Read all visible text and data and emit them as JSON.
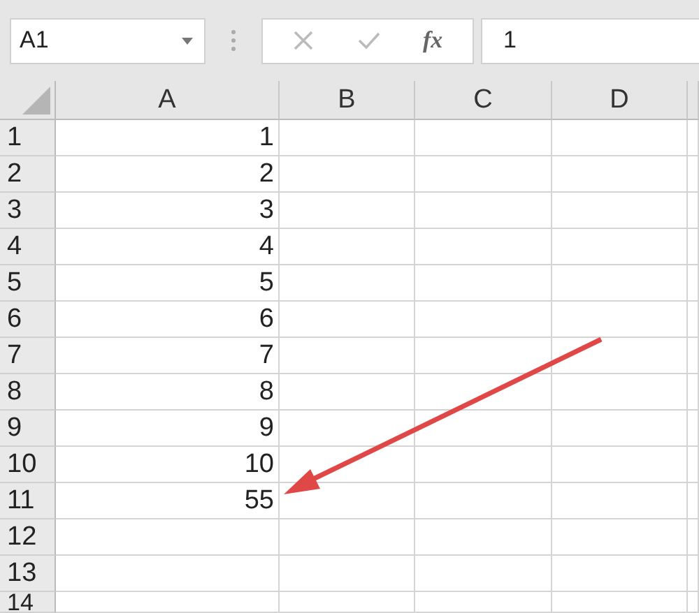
{
  "formula_bar": {
    "name_box": "A1",
    "function_button": "fx",
    "value": "1"
  },
  "columns": [
    "A",
    "B",
    "C",
    "D"
  ],
  "rows": [
    {
      "number": "1",
      "cells": [
        "1"
      ]
    },
    {
      "number": "2",
      "cells": [
        "2"
      ]
    },
    {
      "number": "3",
      "cells": [
        "3"
      ]
    },
    {
      "number": "4",
      "cells": [
        "4"
      ]
    },
    {
      "number": "5",
      "cells": [
        "5"
      ]
    },
    {
      "number": "6",
      "cells": [
        "6"
      ]
    },
    {
      "number": "7",
      "cells": [
        "7"
      ]
    },
    {
      "number": "8",
      "cells": [
        "8"
      ]
    },
    {
      "number": "9",
      "cells": [
        "9"
      ]
    },
    {
      "number": "10",
      "cells": [
        "10"
      ]
    },
    {
      "number": "11",
      "cells": [
        "55"
      ]
    },
    {
      "number": "12"
    },
    {
      "number": "13"
    },
    {
      "number": "14"
    }
  ]
}
